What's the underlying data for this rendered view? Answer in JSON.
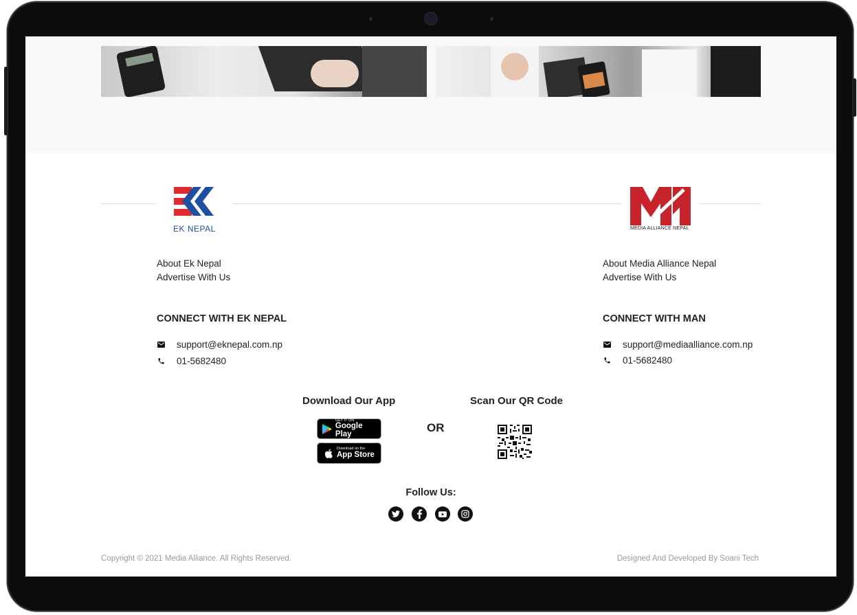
{
  "ek_nepal": {
    "logo_text": "EK NEPAL",
    "links": [
      "About Ek Nepal",
      "Advertise With Us"
    ],
    "connect_heading": "CONNECT WITH EK NEPAL",
    "email": "support@eknepal.com.np",
    "phone": "01-5682480"
  },
  "media_alliance": {
    "logo_text": "MEDIA ALLIANCE NEPAL",
    "links": [
      "About Media Alliance Nepal",
      "Advertise With Us"
    ],
    "connect_heading": "CONNECT WITH MAN",
    "email": "support@mediaalliance.com.np",
    "phone": "01-5682480"
  },
  "app": {
    "download_title": "Download Our App",
    "google_small": "GET IT ON",
    "google_big": "Google Play",
    "apple_small": "Download on the",
    "apple_big": "App Store",
    "or_label": "OR",
    "qr_title": "Scan Our QR Code"
  },
  "follow": {
    "label": "Follow Us:",
    "icons": [
      "twitter-icon",
      "facebook-icon",
      "youtube-icon",
      "instagram-icon"
    ]
  },
  "footer": {
    "copyright": "Copyright © 2021 Media Alliance. All Rights Reserved.",
    "credit": "Designed And Developed By Soani Tech"
  },
  "colors": {
    "ek_red": "#e02a2f",
    "ek_blue": "#1f4fa0",
    "man_red": "#c8222a"
  }
}
